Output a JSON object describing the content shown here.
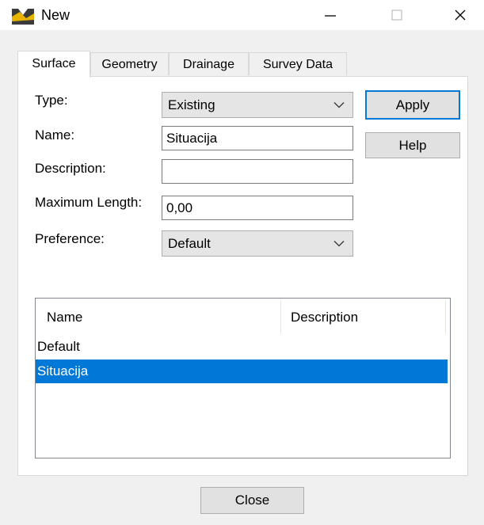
{
  "window": {
    "title": "New",
    "minimize_glyph": "—",
    "maximize_glyph": "☐",
    "close_glyph": "✕"
  },
  "tabs": [
    {
      "label": "Surface",
      "active": true
    },
    {
      "label": "Geometry",
      "active": false
    },
    {
      "label": "Drainage",
      "active": false
    },
    {
      "label": "Survey Data",
      "active": false
    }
  ],
  "form": {
    "type_label": "Type:",
    "type_value": "Existing",
    "name_label": "Name:",
    "name_value": "Situacija",
    "description_label": "Description:",
    "description_value": "",
    "max_length_label": "Maximum Length:",
    "max_length_value": "0,00",
    "preference_label": "Preference:",
    "preference_value": "Default"
  },
  "buttons": {
    "apply": "Apply",
    "help": "Help",
    "close": "Close"
  },
  "list": {
    "columns": [
      "Name",
      "Description"
    ],
    "rows": [
      {
        "name": "Default",
        "description": "",
        "selected": false
      },
      {
        "name": "Situacija",
        "description": "",
        "selected": true
      }
    ]
  },
  "colors": {
    "selection": "#0078d7",
    "default_button_border": "#0078d7",
    "dialog_background": "#f0f0f0"
  }
}
